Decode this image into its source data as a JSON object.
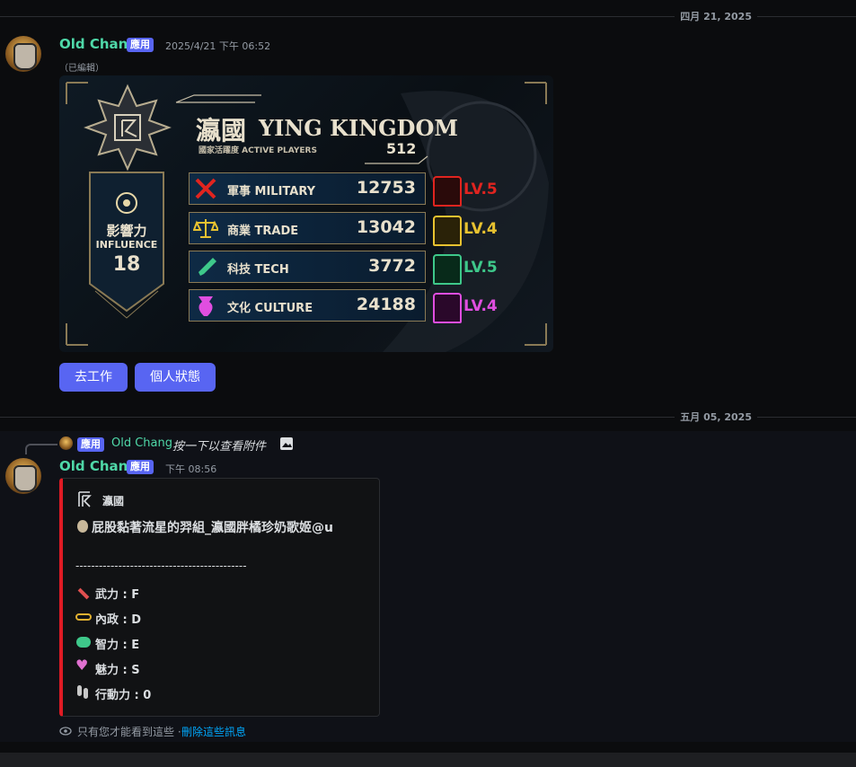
{
  "date_divider_1": "四月 21, 2025",
  "date_divider_2": "五月 05, 2025",
  "message1": {
    "username": "Old Chang",
    "badge": "應用",
    "timestamp": "2025/4/21 下午 06:52",
    "edited": "（已編輯）",
    "card": {
      "kingdom_cn": "瀛國",
      "kingdom_en": "YING KINGDOM",
      "active_label": "國家活躍度 ACTIVE PLAYERS",
      "active_value": "512",
      "influence_cn": "影響力",
      "influence_en": "INFLUENCE",
      "influence_value": "18",
      "stats": [
        {
          "label": "軍事 MILITARY",
          "value": "12753",
          "level": "LV.5",
          "color": "#e0241f",
          "icon": "crossed-swords-icon"
        },
        {
          "label": "商業 TRADE",
          "value": "13042",
          "level": "LV.4",
          "color": "#e8c230",
          "icon": "scales-icon"
        },
        {
          "label": "科技 TECH",
          "value": "3772",
          "level": "LV.5",
          "color": "#3ec88a",
          "icon": "test-tube-icon"
        },
        {
          "label": "文化 CULTURE",
          "value": "24188",
          "level": "LV.4",
          "color": "#e04ee0",
          "icon": "vase-icon"
        }
      ]
    },
    "buttons": [
      "去工作",
      "個人狀態"
    ]
  },
  "message2": {
    "reply": {
      "badge": "應用",
      "username": "Old Chang",
      "text": "按一下以查看附件"
    },
    "username": "Old Chang",
    "badge": "應用",
    "timestamp": "下午 08:56",
    "embed": {
      "kingdom": "瀛國",
      "name_line": "屁股黏著流星的羿組_瀛國胖橘珍奶歌姬@u",
      "separator": "--------------------------------------------",
      "attributes": [
        {
          "label": "武力 : F",
          "icon": "dagger-icon",
          "color": "#e05050"
        },
        {
          "label": "內政 : D",
          "icon": "glasses-icon",
          "color": "#e0b030"
        },
        {
          "label": "智力 : E",
          "icon": "brain-icon",
          "color": "#3ec88a"
        },
        {
          "label": "魅力 : S",
          "icon": "heart-icon",
          "color": "#e070d0"
        },
        {
          "label": "行動力 : 0",
          "icon": "footprints-icon",
          "color": "#c8c8c8"
        }
      ]
    },
    "ephemeral_note": "只有您才能看到這些 · ",
    "dismiss_link": "刪除這些訊息"
  }
}
